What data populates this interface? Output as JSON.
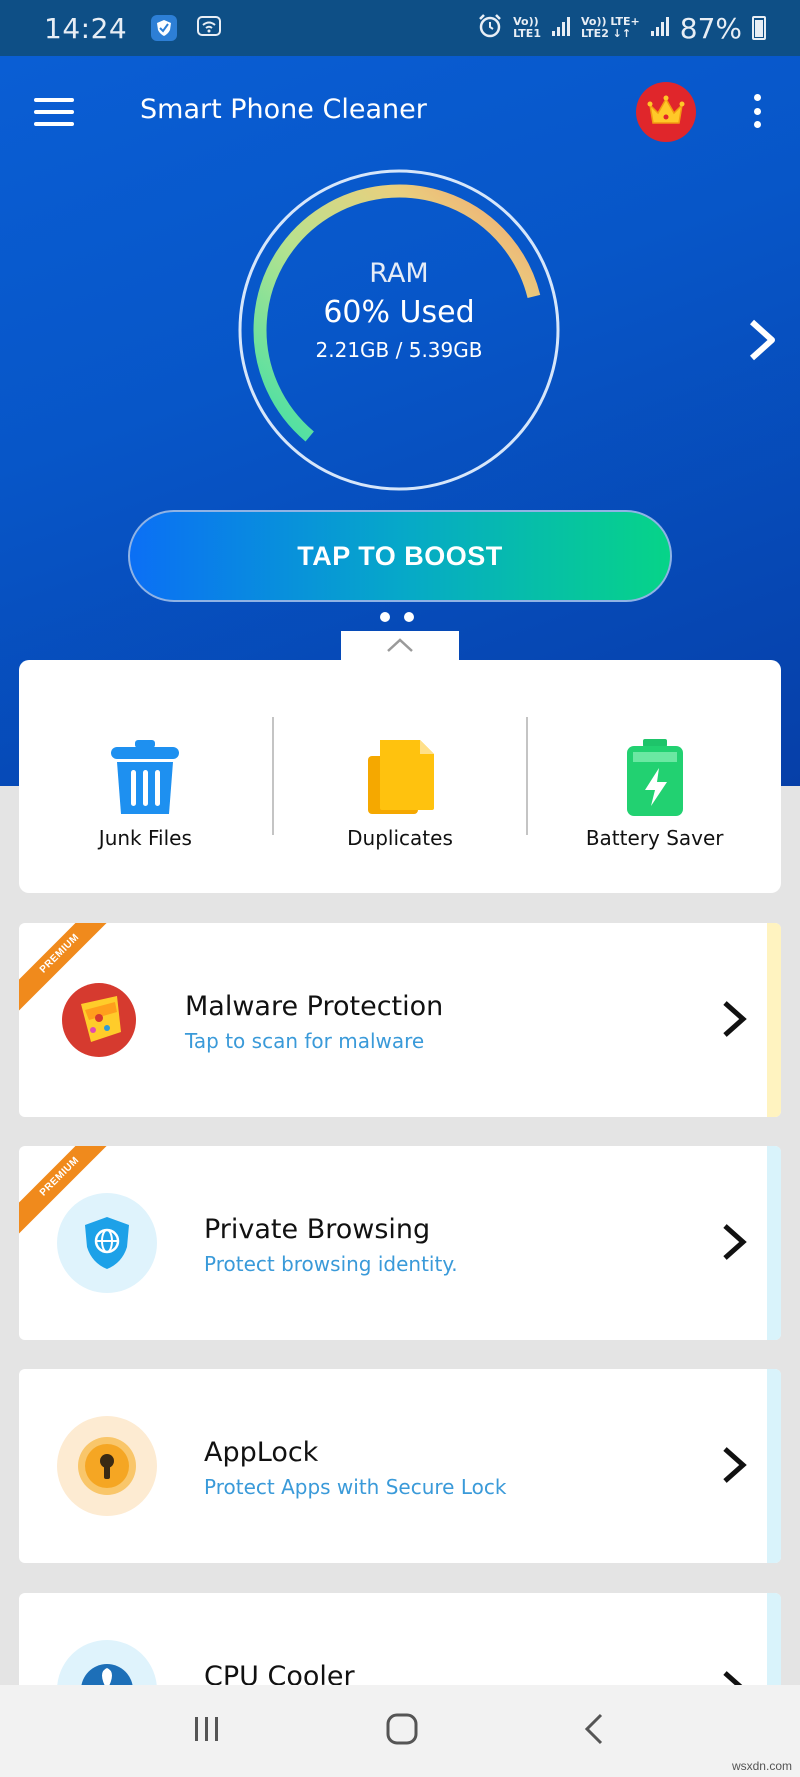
{
  "status_bar": {
    "time": "14:24",
    "battery": "87%",
    "sim1": [
      "Vo))",
      "LTE1"
    ],
    "sim2": [
      "Vo)) LTE+",
      "LTE2 ↓↑"
    ]
  },
  "header": {
    "title": "Smart Phone Cleaner",
    "icons": [
      "menu-icon",
      "crown-icon",
      "more-vert-icon"
    ]
  },
  "ram": {
    "label": "RAM",
    "percent_text": "60% Used",
    "detail": "2.21GB / 5.39GB",
    "used_fraction": 0.6
  },
  "boost": {
    "label": "TAP TO BOOST"
  },
  "tools": [
    {
      "label": "Junk Files",
      "icon": "trash-icon"
    },
    {
      "label": "Duplicates",
      "icon": "duplicate-files-icon"
    },
    {
      "label": "Battery Saver",
      "icon": "battery-charging-icon"
    }
  ],
  "features": [
    {
      "title": "Malware Protection",
      "subtitle": "Tap to scan for malware",
      "badge": "PREMIUM",
      "icon": "malware-shield-icon"
    },
    {
      "title": "Private Browsing",
      "subtitle": "Protect browsing identity.",
      "badge": "PREMIUM",
      "icon": "globe-shield-icon"
    },
    {
      "title": "AppLock",
      "subtitle": "Protect Apps with Secure Lock",
      "icon": "keyhole-lock-icon"
    },
    {
      "title": "CPU Cooler",
      "icon": "fan-icon"
    }
  ],
  "colors": {
    "hero_blue": "#0756c8",
    "boost_start": "#0b6ff5",
    "boost_end": "#06d488",
    "premium_orange": "#f08a1c",
    "subtitle_blue": "#3a9ad9"
  },
  "watermark": "wsxdn.com"
}
